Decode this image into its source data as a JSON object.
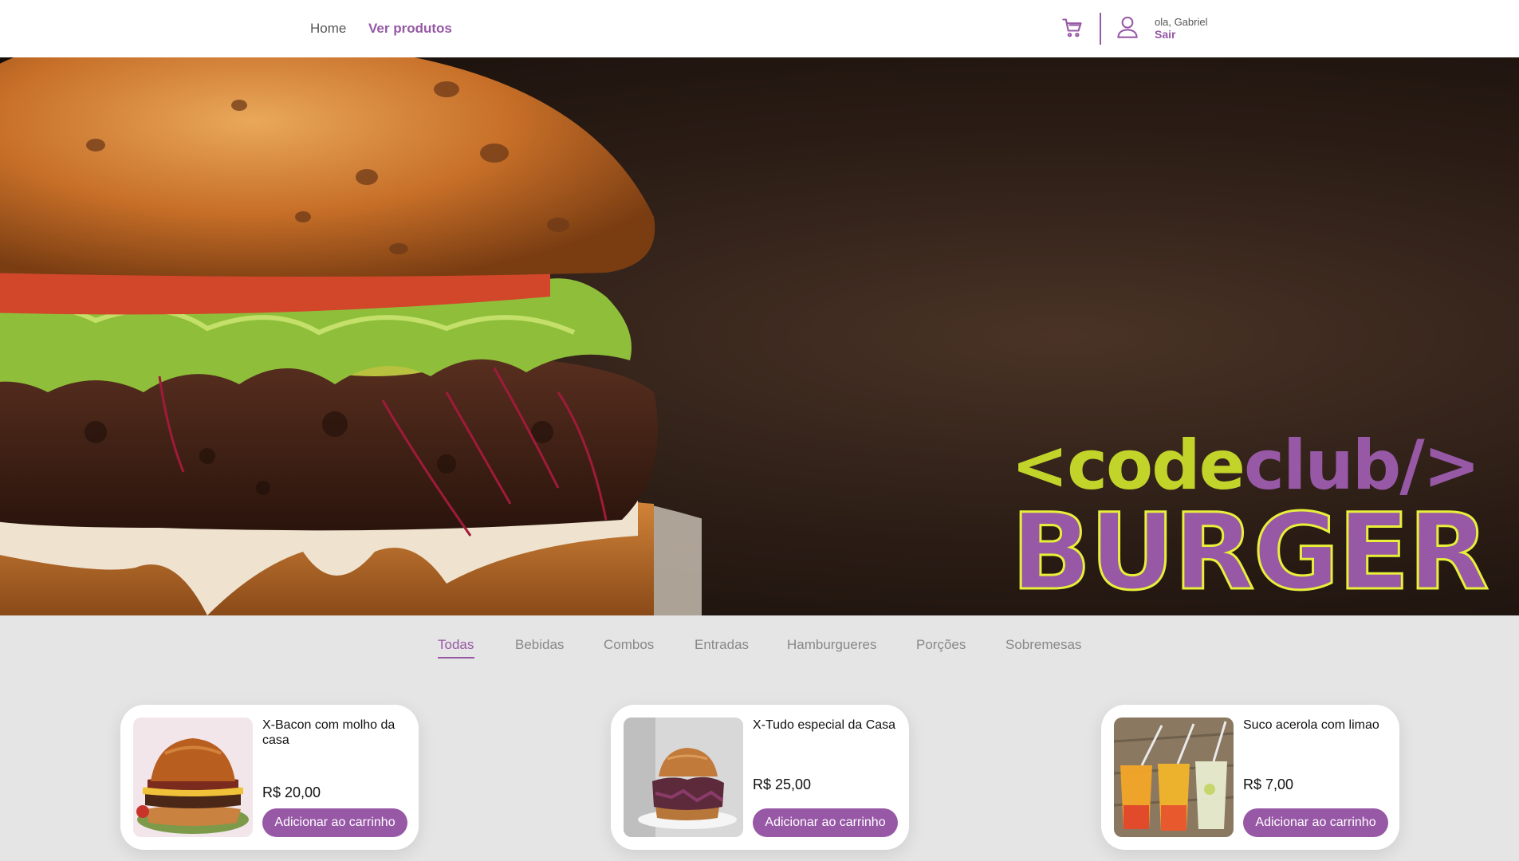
{
  "header": {
    "nav": {
      "home": "Home",
      "products": "Ver produtos"
    },
    "user": {
      "greeting": "ola, Gabriel",
      "logout": "Sair"
    }
  },
  "hero": {
    "logo_open": "<",
    "logo_code": "code",
    "logo_club": "club/>",
    "logo_burger": "BURGER"
  },
  "categories": {
    "items": [
      "Todas",
      "Bebidas",
      "Combos",
      "Entradas",
      "Hamburgueres",
      "Porções",
      "Sobremesas"
    ],
    "active": "Todas"
  },
  "products": [
    {
      "name": "X-Bacon com molho da casa",
      "price": "R$ 20,00",
      "button": "Adicionar ao carrinho"
    },
    {
      "name": "X-Tudo especial da Casa",
      "price": "R$ 25,00",
      "button": "Adicionar ao carrinho"
    },
    {
      "name": "Suco acerola com limao",
      "price": "R$ 7,00",
      "button": "Adicionar ao carrinho"
    }
  ],
  "colors": {
    "brand": "#9758a6",
    "accent": "#c2d42a",
    "background": "#e5e5e5"
  },
  "icons": {
    "cart": "cart-icon",
    "user": "user-icon"
  }
}
